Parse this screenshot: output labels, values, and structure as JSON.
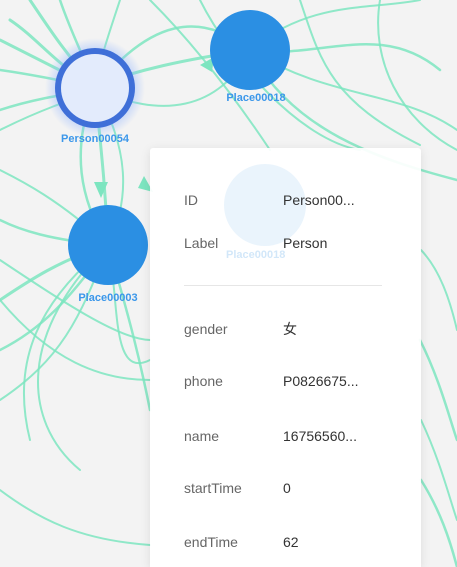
{
  "graph": {
    "nodes": [
      {
        "id": "person00054",
        "label": "Person00054",
        "type": "person",
        "selected": true
      },
      {
        "id": "place00018",
        "label": "Place00018",
        "type": "place"
      },
      {
        "id": "place00003",
        "label": "Place00003",
        "type": "place"
      }
    ],
    "hidden_node_label": "Place00018",
    "colors": {
      "edge": "#7de5c0",
      "place_fill": "#2b8fe3",
      "person_fill": "#e3ebfc",
      "person_ring": "#3f6fd8",
      "label": "#3b97ea",
      "background": "#f3f3f3"
    }
  },
  "detail_panel": {
    "id_key": "ID",
    "id_value": "Person00...",
    "label_key": "Label",
    "label_value": "Person",
    "properties": [
      {
        "key": "gender",
        "value": "女"
      },
      {
        "key": "phone",
        "value": "P0826675..."
      },
      {
        "key": "name",
        "value": "16756560..."
      },
      {
        "key": "startTime",
        "value": "0"
      },
      {
        "key": "endTime",
        "value": "62"
      }
    ]
  }
}
